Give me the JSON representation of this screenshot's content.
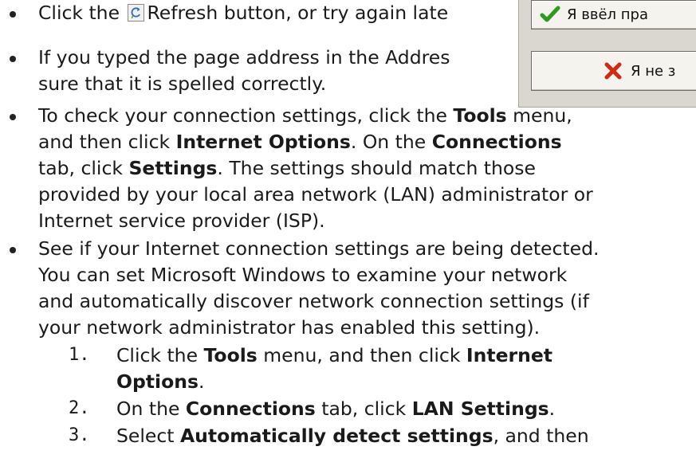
{
  "instructions": {
    "bullet1": {
      "pre": "Click the ",
      "post": "Refresh button, or try again late"
    },
    "bullet2": {
      "line1": "If you typed the page address in the Addres",
      "line2": "sure that it is spelled correctly."
    },
    "bullet3": {
      "l1_pre": "To check your connection settings, click the ",
      "l1_bold": "Tools",
      "l1_post": " menu,",
      "l2_pre": "and then click ",
      "l2_bold1": "Internet Options",
      "l2_mid": ". On the ",
      "l2_bold2": "Connections",
      "l3_pre": "tab, click ",
      "l3_bold": "Settings",
      "l3_post": ". The settings should match those",
      "l4": "provided by your local area network (LAN) administrator or",
      "l5": "Internet service provider (ISP)."
    },
    "bullet4": {
      "l1": "See if your Internet connection settings are being detected.",
      "l2": "You can set Microsoft Windows to examine your network",
      "l3": "and automatically discover network connection settings (if",
      "l4": "your network administrator has enabled this setting)."
    },
    "steps": [
      {
        "num": "1.",
        "pre": "Click the ",
        "bold1": "Tools",
        "mid": " menu, and then click ",
        "bold2": "Internet",
        "cont": "Options",
        "cont_post": "."
      },
      {
        "num": "2.",
        "pre": "On the ",
        "bold1": "Connections",
        "mid": " tab, click ",
        "bold2": "LAN Settings",
        "post": "."
      },
      {
        "num": "3.",
        "pre": "Select ",
        "bold1": "Automatically detect settings",
        "mid": ", and then"
      }
    ]
  },
  "dialog": {
    "confirm_label": "Я ввёл пра",
    "cancel_label": "Я не з",
    "confirm_icon": "checkmark-icon",
    "cancel_icon": "x-icon",
    "confirm_color": "#2e9a1f",
    "cancel_color": "#d02a12"
  },
  "icons": {
    "refresh": "refresh-icon"
  }
}
